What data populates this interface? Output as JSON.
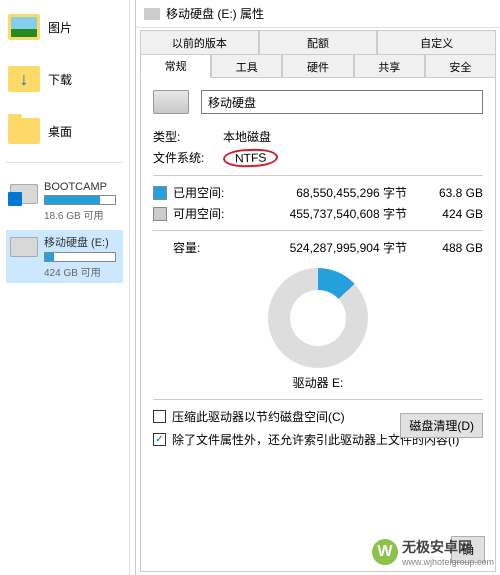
{
  "folders": {
    "pictures": "图片",
    "downloads": "下载",
    "desktop": "桌面"
  },
  "drives": {
    "bootcamp": {
      "name": "BOOTCAMP",
      "free": "18.6 GB 可用",
      "pct": 78
    },
    "removable": {
      "name": "移动硬盘 (E:)",
      "free": "424 GB 可用",
      "pct": 13
    }
  },
  "dialog": {
    "title": "移动硬盘 (E:) 属性",
    "tabs_top": [
      "以前的版本",
      "配额",
      "自定义"
    ],
    "tabs_main": [
      "常规",
      "工具",
      "硬件",
      "共享",
      "安全"
    ],
    "name_value": "移动硬盘",
    "type_label": "类型:",
    "type_value": "本地磁盘",
    "fs_label": "文件系统:",
    "fs_value": "NTFS",
    "used_label": "已用空间:",
    "used_bytes": "68,550,455,296 字节",
    "used_human": "63.8 GB",
    "free_label": "可用空间:",
    "free_bytes": "455,737,540,608 字节",
    "free_human": "424 GB",
    "cap_label": "容量:",
    "cap_bytes": "524,287,995,904 字节",
    "cap_human": "488 GB",
    "donut_label": "驱动器 E:",
    "cleanup": "磁盘清理(D)",
    "compress": "压缩此驱动器以节约磁盘空间(C)",
    "index": "除了文件属性外，还允许索引此驱动器上文件的内容(I)",
    "ok": "确"
  },
  "watermark": {
    "title": "无极安卓网",
    "sub": "www.wjhotelgroup.com"
  }
}
